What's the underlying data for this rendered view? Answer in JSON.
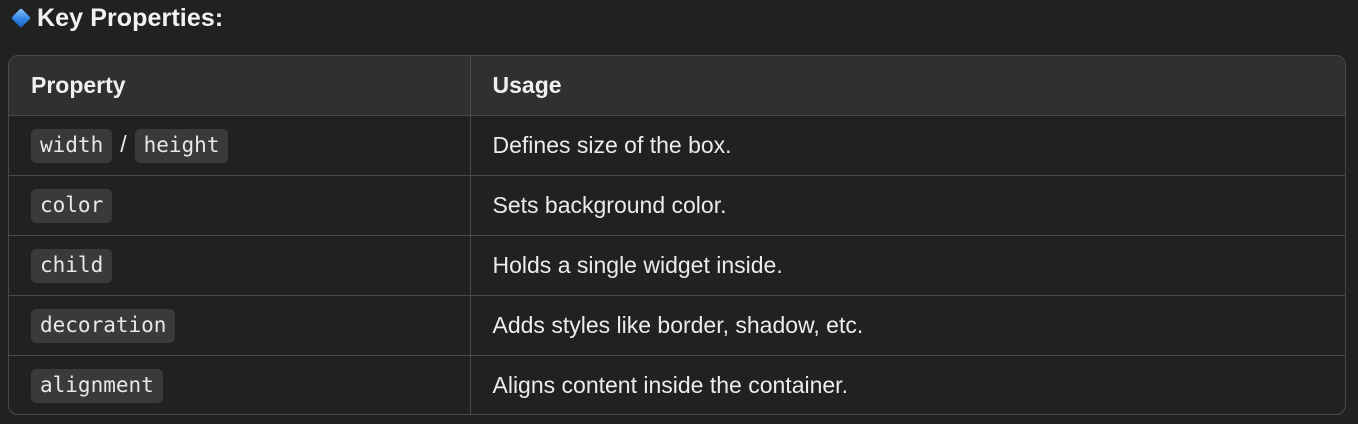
{
  "heading": {
    "icon": "blue-diamond-icon",
    "text": "Key Properties:"
  },
  "table": {
    "headers": [
      "Property",
      "Usage"
    ],
    "rows": [
      {
        "codes": [
          "width",
          "height"
        ],
        "separator": "/",
        "usage": "Defines size of the box."
      },
      {
        "codes": [
          "color"
        ],
        "usage": "Sets background color."
      },
      {
        "codes": [
          "child"
        ],
        "usage": "Holds a single widget inside."
      },
      {
        "codes": [
          "decoration"
        ],
        "usage": "Adds styles like border, shadow, etc."
      },
      {
        "codes": [
          "alignment"
        ],
        "usage": "Aligns content inside the container."
      }
    ]
  },
  "colors": {
    "background": "#212121",
    "header_bg": "#303030",
    "border": "#4a4a4a",
    "code_bg": "#3a3a3a",
    "diamond": "#2f86e6"
  }
}
